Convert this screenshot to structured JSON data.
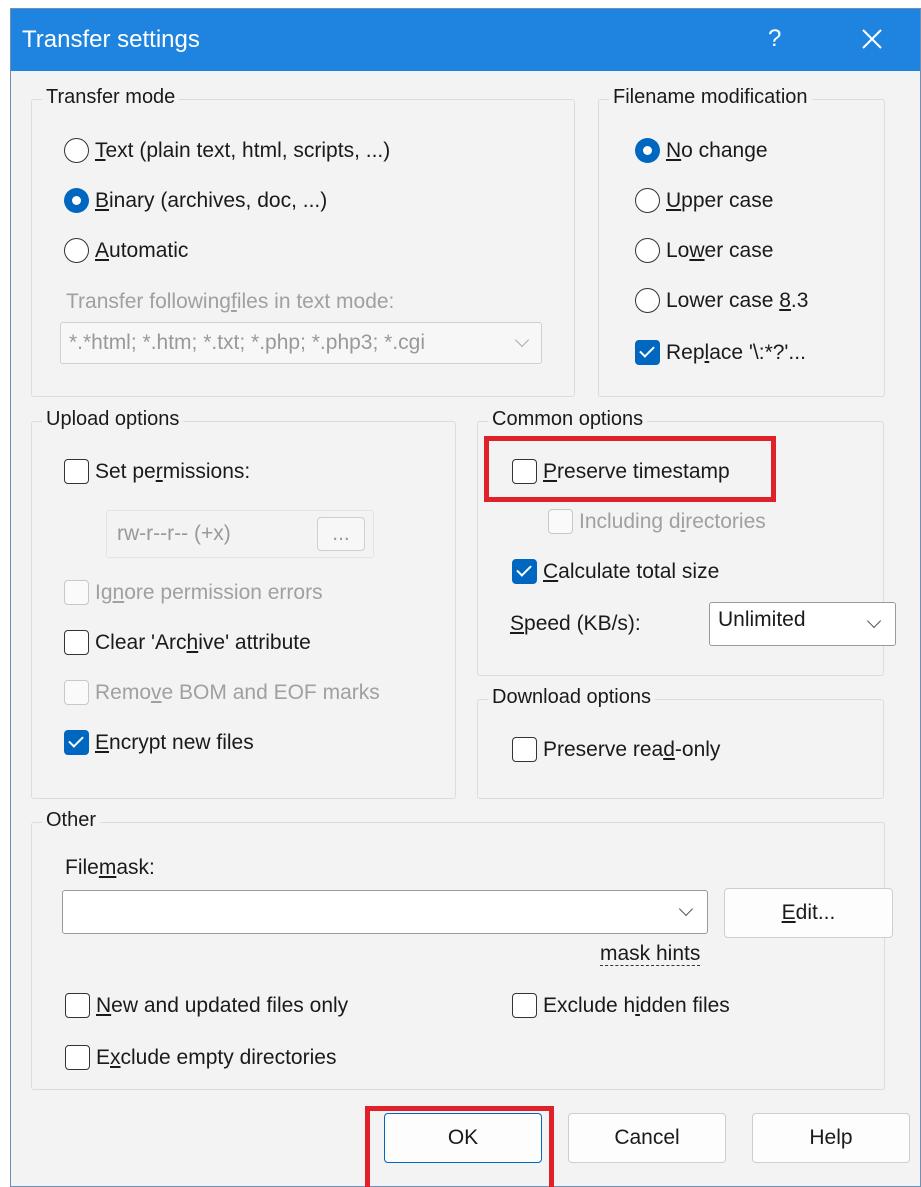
{
  "window": {
    "title": "Transfer settings",
    "help_glyph": "?",
    "close_glyph": "×"
  },
  "transfer_mode": {
    "legend": "Transfer mode",
    "options": [
      {
        "pre": "",
        "key": "T",
        "post": "ext (plain text, html, scripts, ...)",
        "selected": false
      },
      {
        "pre": "",
        "key": "B",
        "post": "inary (archives, doc, ...)",
        "selected": true
      },
      {
        "pre": "",
        "key": "A",
        "post": "utomatic",
        "selected": false
      }
    ],
    "text_mode_label": {
      "pre": "Transfer following ",
      "key": "f",
      "post": "iles in text mode:"
    },
    "text_mode_value": "*.*html; *.htm; *.txt; *.php; *.php3; *.cgi"
  },
  "filename_modification": {
    "legend": "Filename modification",
    "options": [
      {
        "pre": "",
        "key": "N",
        "post": "o change",
        "selected": true
      },
      {
        "pre": "",
        "key": "U",
        "post": "pper case",
        "selected": false
      },
      {
        "pre": "Lo",
        "key": "w",
        "post": "er case",
        "selected": false
      },
      {
        "pre": "Lower case ",
        "key": "8",
        "post": ".3",
        "selected": false
      }
    ],
    "replace": {
      "pre": "Rep",
      "key": "l",
      "post": "ace '\\:*?'...",
      "checked": true
    }
  },
  "upload_options": {
    "legend": "Upload options",
    "set_permissions": {
      "pre": "Set pe",
      "key": "r",
      "post": "missions:",
      "checked": false
    },
    "permissions_value": "rw-r--r-- (+x)",
    "permissions_button": "...",
    "ignore_errors": {
      "pre": "Ig",
      "key": "n",
      "post": "ore permission errors",
      "checked": false
    },
    "clear_archive": {
      "pre": "Clear 'Arc",
      "key": "h",
      "post": "ive' attribute",
      "checked": false
    },
    "remove_bom": {
      "pre": "Remo",
      "key": "v",
      "post": "e BOM and EOF marks",
      "checked": false
    },
    "encrypt": {
      "pre": "",
      "key": "E",
      "post": "ncrypt new files",
      "checked": true
    }
  },
  "common_options": {
    "legend": "Common options",
    "preserve_timestamp": {
      "pre": "",
      "key": "P",
      "post": "reserve timestamp",
      "checked": false
    },
    "including_dirs": {
      "pre": "Including d",
      "key": "i",
      "post": "rectories",
      "checked": false
    },
    "calculate_size": {
      "pre": "",
      "key": "C",
      "post": "alculate total size",
      "checked": true
    },
    "speed_label": {
      "pre": "",
      "key": "S",
      "post": "peed (KB/s):"
    },
    "speed_value": "Unlimited"
  },
  "download_options": {
    "legend": "Download options",
    "preserve_readonly": {
      "pre": "Preserve rea",
      "key": "d",
      "post": "-only",
      "checked": false
    }
  },
  "other": {
    "legend": "Other",
    "file_mask_label": {
      "pre": "File ",
      "key": "m",
      "post": "ask:"
    },
    "file_mask_value": "",
    "edit_button": {
      "pre": "",
      "key": "E",
      "post": "dit..."
    },
    "mask_hints": "mask hints",
    "new_updated": {
      "pre": "",
      "key": "N",
      "post": "ew and updated files only",
      "checked": false
    },
    "exclude_hidden": {
      "pre": "Exclude h",
      "key": "i",
      "post": "dden files",
      "checked": false
    },
    "exclude_empty": {
      "pre": "E",
      "key": "x",
      "post": "clude empty directories",
      "checked": false
    }
  },
  "buttons": {
    "ok": "OK",
    "cancel": "Cancel",
    "help": "Help"
  },
  "colors": {
    "titlebar": "#1f83e0",
    "accent": "#0067c0",
    "highlight": "#e0212a"
  }
}
